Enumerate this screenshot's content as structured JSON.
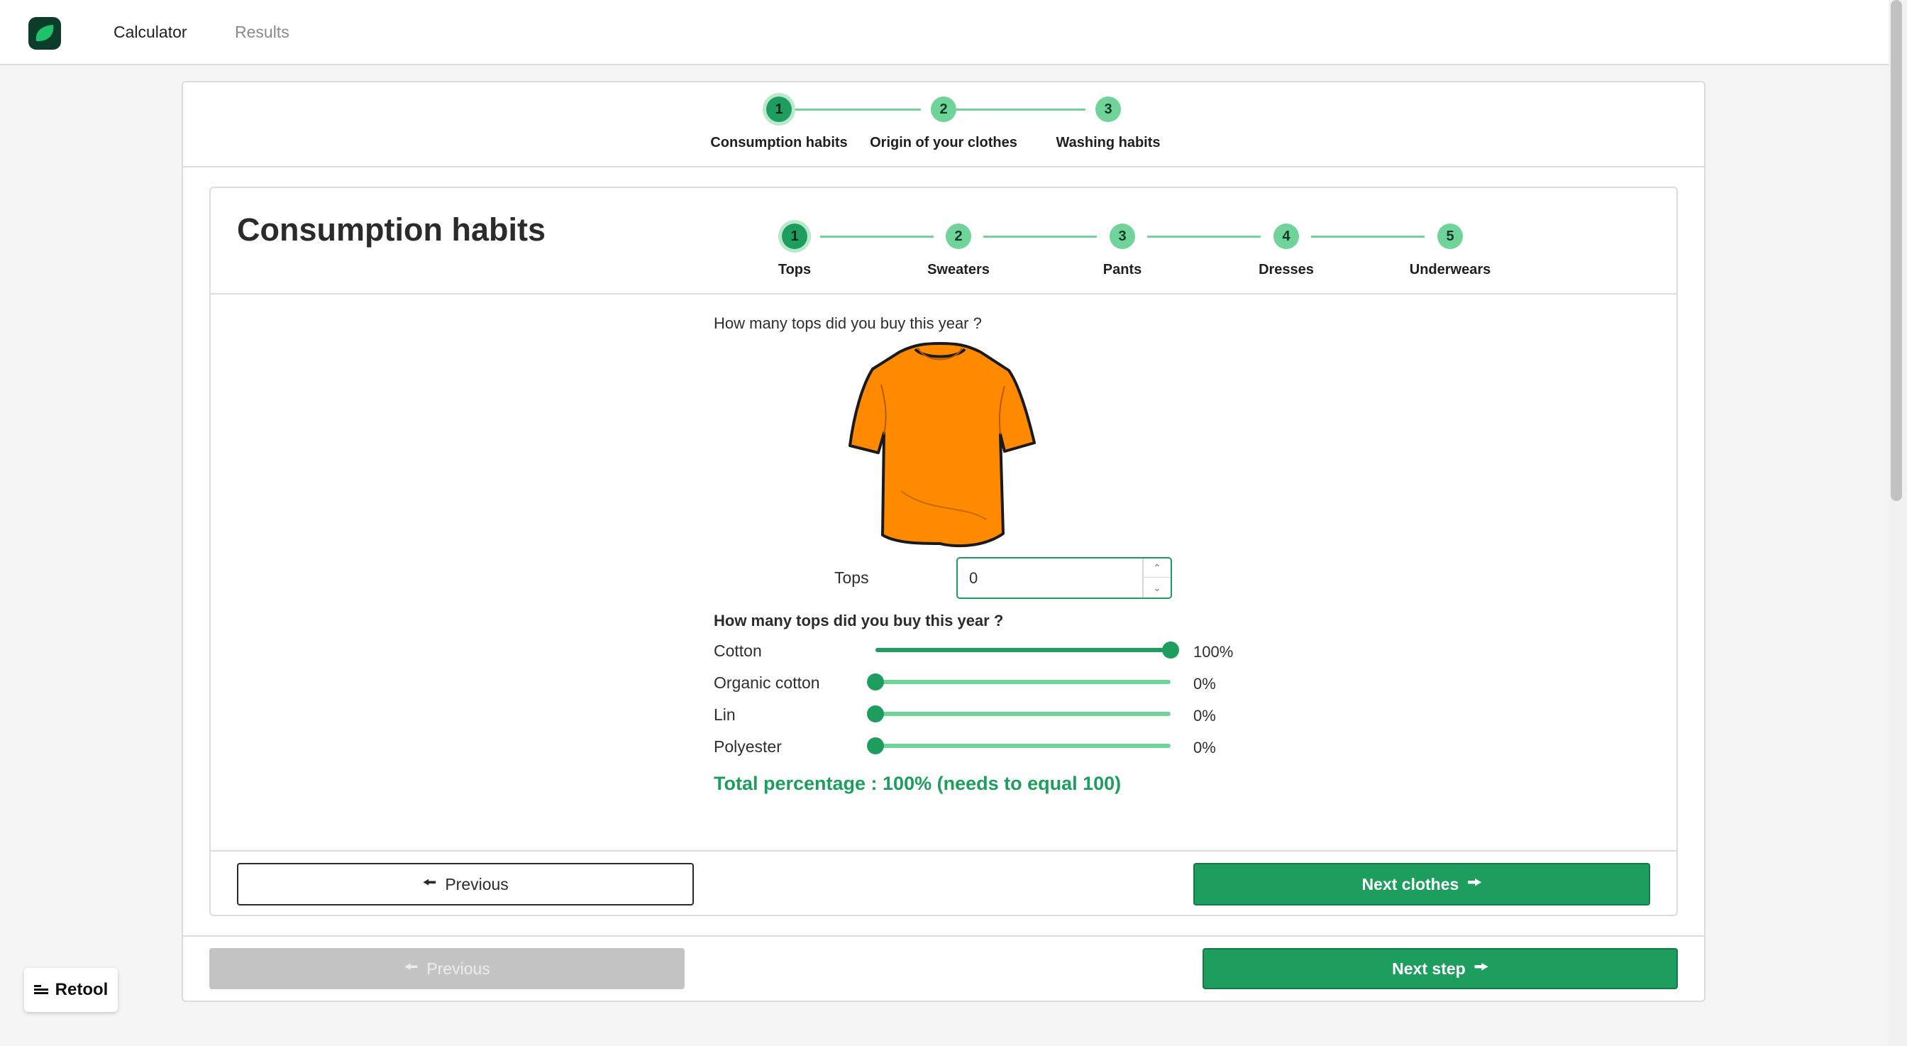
{
  "nav": {
    "logo": "leaf-logo",
    "items": [
      {
        "label": "Calculator"
      },
      {
        "label": "Results"
      }
    ]
  },
  "main_steps": [
    {
      "number": "1",
      "label": "Consumption habits"
    },
    {
      "number": "2",
      "label": "Origin of your clothes"
    },
    {
      "number": "3",
      "label": "Washing habits"
    }
  ],
  "section": {
    "title": "Consumption habits",
    "clothes_steps": [
      {
        "number": "1",
        "label": "Tops"
      },
      {
        "number": "2",
        "label": "Sweaters"
      },
      {
        "number": "3",
        "label": "Pants"
      },
      {
        "number": "4",
        "label": "Dresses"
      },
      {
        "number": "5",
        "label": "Underwears"
      }
    ],
    "question": "How many tops did you buy this year ?",
    "image_icon": "tshirt-icon",
    "quantity": {
      "label": "Tops",
      "value": "0"
    },
    "materials_question": "How many tops did you buy this year ?",
    "materials": [
      {
        "label": "Cotton",
        "percent": 100,
        "display": "100%"
      },
      {
        "label": "Organic cotton",
        "percent": 0,
        "display": "0%"
      },
      {
        "label": "Lin",
        "percent": 0,
        "display": "0%"
      },
      {
        "label": "Polyester",
        "percent": 0,
        "display": "0%"
      }
    ],
    "total": "Total percentage : 100% (needs to equal 100)",
    "previous_label": "Previous",
    "next_label": "Next clothes"
  },
  "footer": {
    "previous_label": "Previous",
    "next_label": "Next step"
  },
  "badge": {
    "label": "Retool"
  },
  "colors": {
    "accent": "#1d9e5e",
    "accent_light": "#6fd39a",
    "shirt": "#ff8a00",
    "disabled": "#c4c4c4"
  }
}
